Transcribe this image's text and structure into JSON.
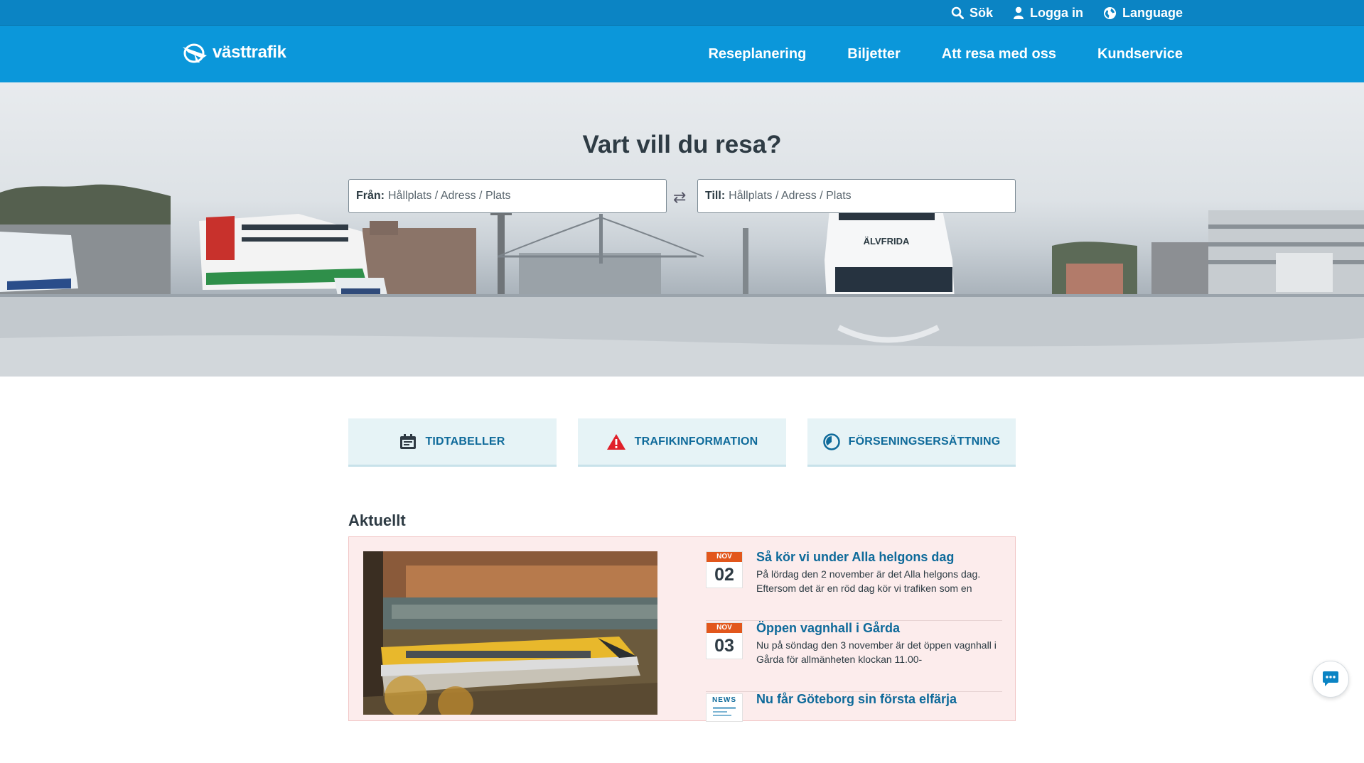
{
  "topbar": {
    "search_label": "Sök",
    "login_label": "Logga in",
    "language_label": "Language"
  },
  "header": {
    "logo_text": "västtrafik",
    "nav": [
      {
        "label": "Reseplanering"
      },
      {
        "label": "Biljetter"
      },
      {
        "label": "Att resa med oss"
      },
      {
        "label": "Kundservice"
      }
    ]
  },
  "hero": {
    "title": "Vart vill du resa?",
    "from_label": "Från:",
    "from_placeholder": "Hållplats / Adress / Plats",
    "to_label": "Till:",
    "to_placeholder": "Hållplats / Adress / Plats",
    "ferry_name": "ÄLVFRIDA"
  },
  "tiles": [
    {
      "label": "TIDTABELLER",
      "icon": "timetable-icon"
    },
    {
      "label": "TRAFIKINFORMATION",
      "icon": "warning-icon"
    },
    {
      "label": "FÖRSENINGSERSÄTTNING",
      "icon": "clock-icon"
    }
  ],
  "news": {
    "heading": "Aktuellt",
    "items": [
      {
        "month": "NOV",
        "day": "02",
        "title": "Så kör vi under Alla helgons dag",
        "text": "På lördag den 2 november är det Alla helgons dag. Eftersom det är en röd dag kör vi trafiken som en"
      },
      {
        "month": "NOV",
        "day": "03",
        "title": "Öppen vagnhall i Gårda",
        "text": "Nu på söndag den 3 november är det öppen vagnhall i Gårda för allmänheten klockan 11.00-"
      },
      {
        "badge": "NEWS",
        "title": "Nu får Göteborg sin första elfärja",
        "text": ""
      }
    ]
  },
  "colors": {
    "topbar": "#0b84c4",
    "navbar": "#0b97da",
    "tile_bg": "#e6f3f6",
    "news_bg": "#fcecec",
    "date_accent": "#e2571c",
    "link": "#0e6a9a"
  }
}
